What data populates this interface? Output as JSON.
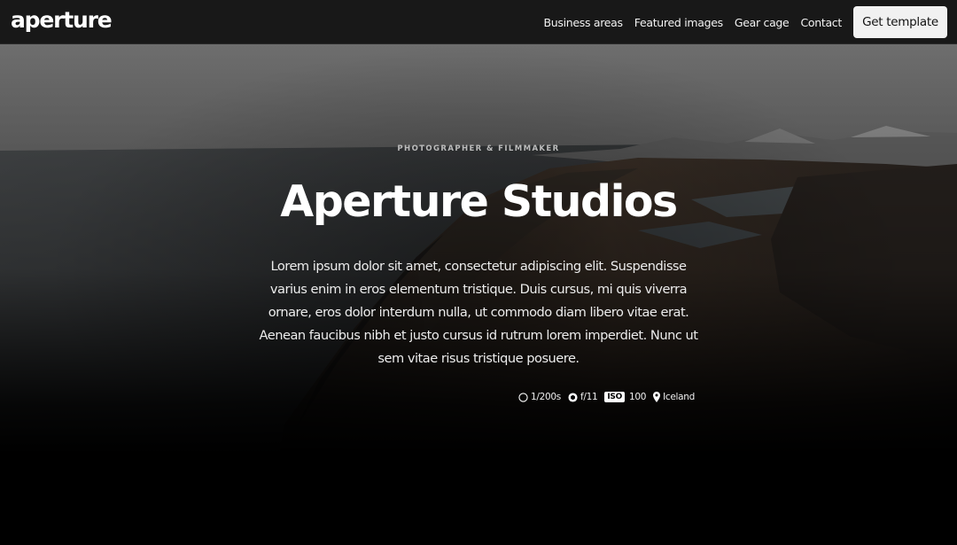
{
  "navbar": {
    "logo": "aperture",
    "links": [
      {
        "label": "Business areas"
      },
      {
        "label": "Featured images"
      },
      {
        "label": "Gear cage"
      },
      {
        "label": "Contact"
      }
    ],
    "cta_label": "Get template"
  },
  "hero": {
    "eyebrow": "PHOTOGRAPHER & FILMMAKER",
    "title": "Aperture Studios",
    "description": "Lorem ipsum dolor sit amet, consectetur adipiscing elit. Suspendisse varius enim in eros elementum tristique. Duis cursus, mi quis viverra ornare, eros dolor interdum nulla, ut commodo diam libero vitae erat. Aenean faucibus nibh et justo cursus id rutrum lorem imperdiet. Nunc ut sem vitae risus tristique posuere.",
    "exif": {
      "shutter": "1/200s",
      "aperture": "f/11",
      "iso_label": "ISO",
      "iso_value": "100",
      "location": "Iceland"
    },
    "icons": {
      "shutter": "shutter-speed-icon",
      "aperture": "aperture-icon",
      "location": "location-pin-icon"
    }
  },
  "colors": {
    "navbar_bg": "#181818",
    "cta_bg": "#f1f1f1",
    "page_bg": "#000000"
  }
}
